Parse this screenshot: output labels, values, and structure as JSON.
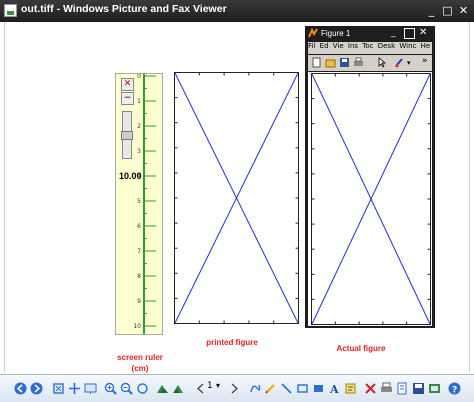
{
  "window": {
    "title": "out.tiff - Windows Picture and Fax Viewer",
    "minimize": "_",
    "maximize": "□",
    "close": "✕"
  },
  "ruler": {
    "close_btn": "✕",
    "minus_btn": "−",
    "value": "10.00",
    "ticks": [
      "0",
      "1",
      "2",
      "3",
      "4",
      "5",
      "6",
      "7",
      "8",
      "9",
      "10"
    ]
  },
  "captions": {
    "ruler": "screen ruler\n(cm)",
    "printed": "printed figure",
    "actual": "Actual figure"
  },
  "figure": {
    "title": "Figure 1",
    "menu": [
      "Fil",
      "Ed",
      "Vie",
      "Ins",
      "Toc",
      "Desk",
      "Winc",
      "He"
    ],
    "menu_more": "↘",
    "toolbar_more": "»"
  },
  "toolbar": {
    "page": "1"
  },
  "colors": {
    "plot_line": "#2030d0",
    "caption": "#e02020",
    "ruler_bg": "#ffffd0",
    "ruler_edge": "#2f9a2f"
  }
}
